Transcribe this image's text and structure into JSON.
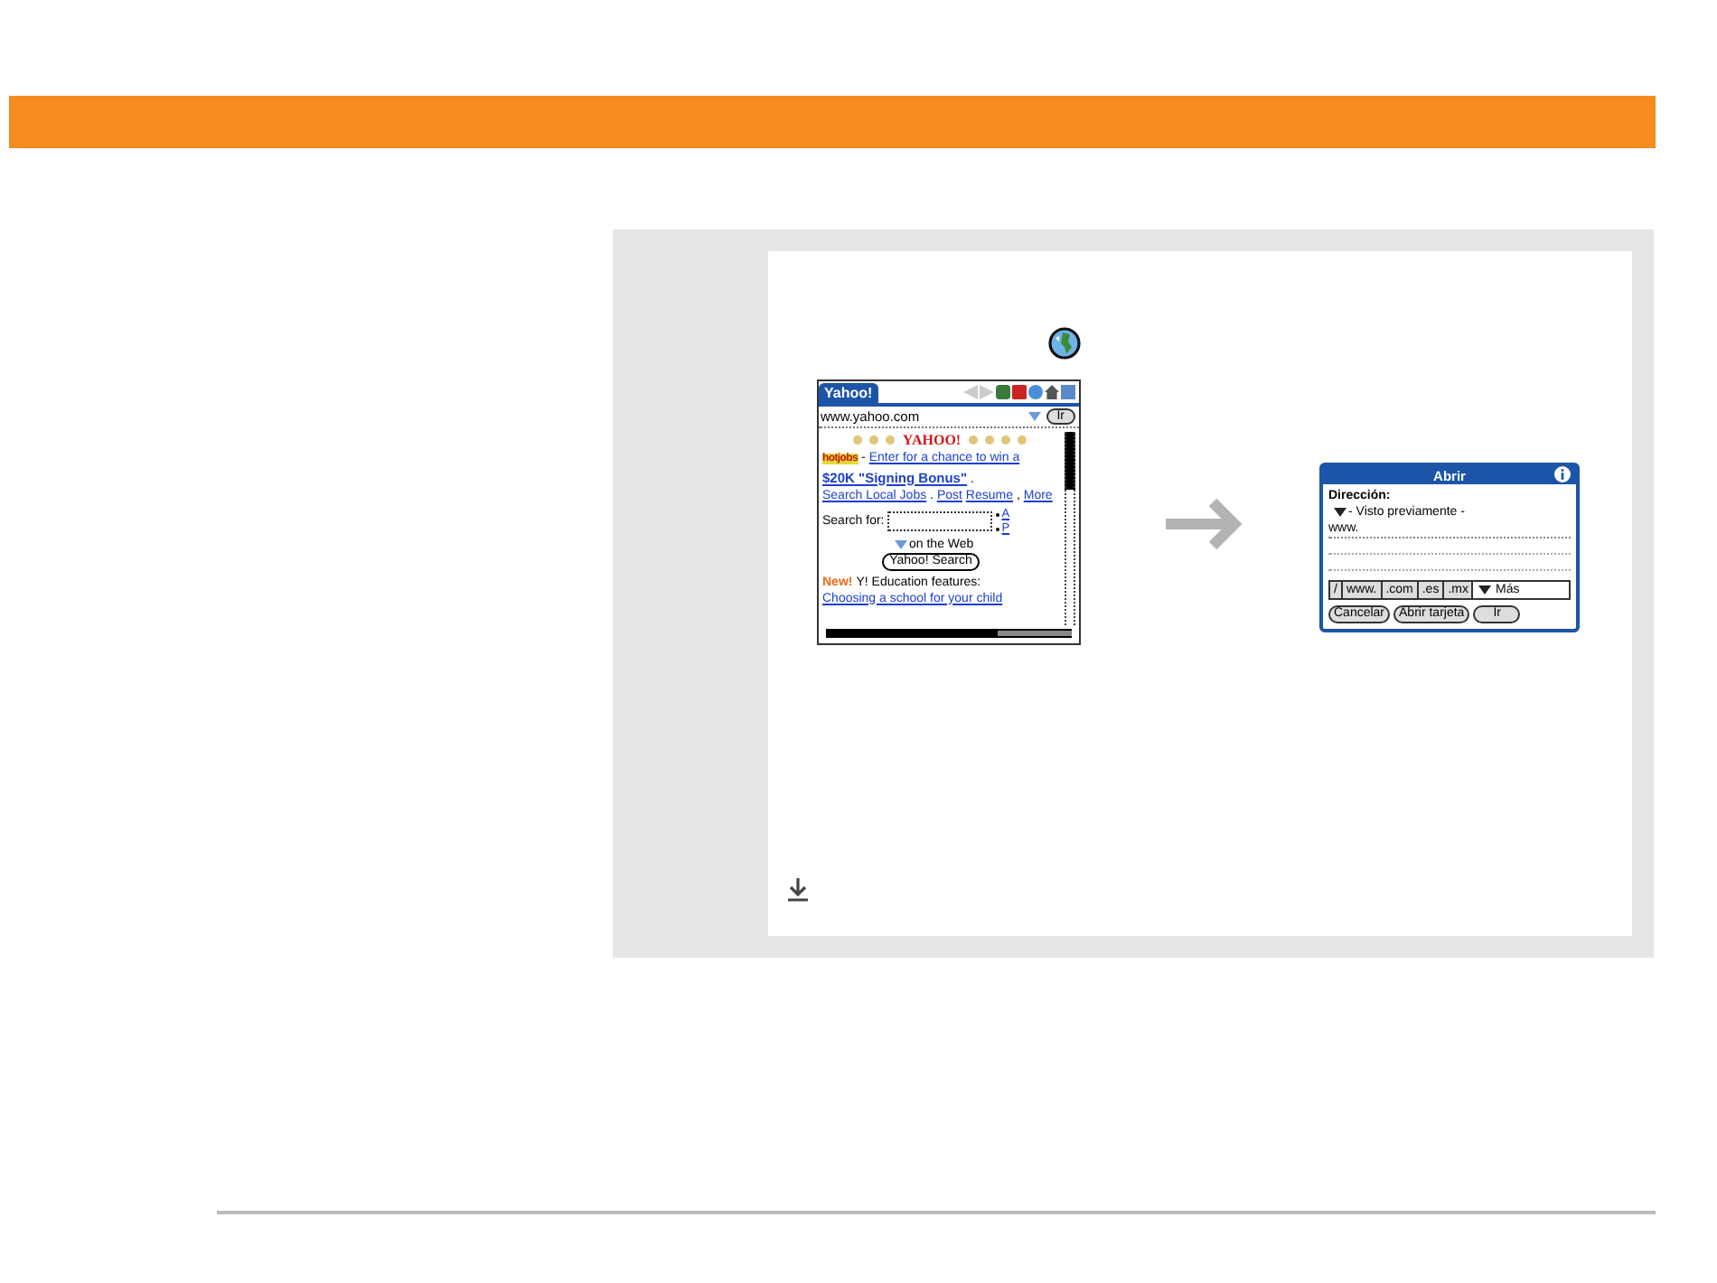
{
  "browser_screen": {
    "tab": "Yahoo!",
    "url": "www.yahoo.com",
    "go_button": "Ir",
    "logo": "YAHOO!",
    "hotjobs_logo": "hotjobs",
    "promo": [
      {
        "kind": "sep",
        "text": "-"
      },
      {
        "kind": "link",
        "text": "Enter for a chance to win a"
      },
      {
        "kind": "bold-link",
        "text": "$20K \"Signing Bonus\""
      },
      {
        "kind": "sep",
        "text": "."
      },
      {
        "kind": "link",
        "text": "Search Local Jobs"
      },
      {
        "kind": "sep",
        "text": "."
      },
      {
        "kind": "link",
        "text": "Post"
      },
      {
        "kind": "link",
        "text": "Resume"
      },
      {
        "kind": "sep",
        "text": ","
      },
      {
        "kind": "link",
        "text": "More"
      }
    ],
    "search_label": "Search for:",
    "side_links": [
      "A",
      "P"
    ],
    "search_scope": "on the Web",
    "search_button": "Yahoo! Search",
    "new_badge": "New!",
    "news_text": "Y! Education features:",
    "news_link": "Choosing a school for your child"
  },
  "dialog": {
    "title": "Abrir",
    "label": "Dirección:",
    "history": "- Visto previamente -",
    "url_value": "www.",
    "shortcuts": [
      "/",
      "www.",
      ".com",
      ".es",
      ".mx"
    ],
    "more_button": "Más",
    "buttons": [
      "Cancelar",
      "Abrir tarjeta",
      "Ir"
    ]
  }
}
